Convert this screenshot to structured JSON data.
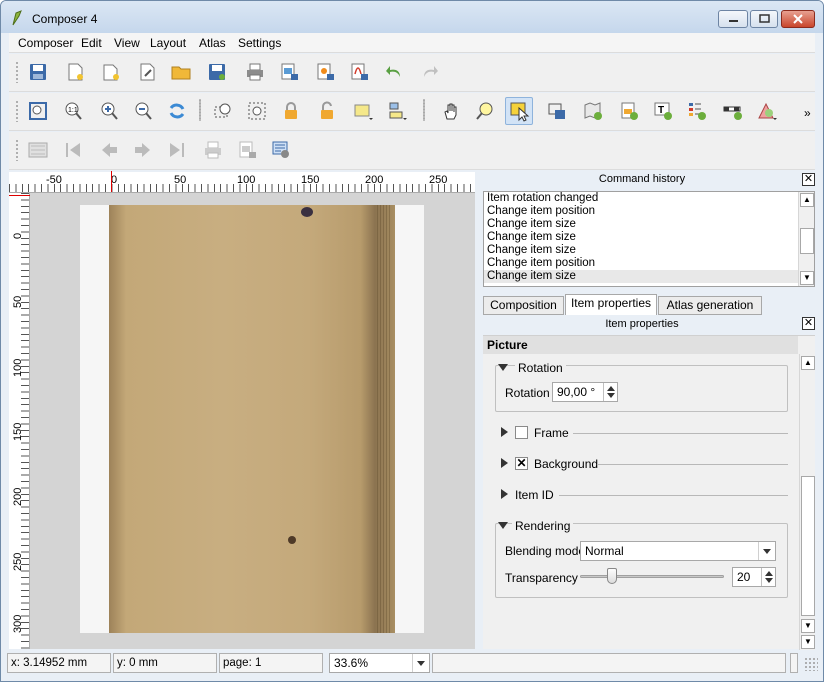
{
  "window": {
    "title": "Composer 4"
  },
  "menu": [
    "Composer",
    "Edit",
    "View",
    "Layout",
    "Atlas",
    "Settings"
  ],
  "ruler": {
    "h_labels": [
      "-50",
      "0",
      "50",
      "100",
      "150",
      "200",
      "250"
    ],
    "v_labels": [
      "0",
      "50",
      "100",
      "150",
      "200",
      "250",
      "300"
    ]
  },
  "command_history": {
    "title": "Command history",
    "items": [
      "Item rotation changed",
      "Change item position",
      "Change item size",
      "Change item size",
      "Change item size",
      "Change item position",
      "Change item size"
    ],
    "selected_index": 6
  },
  "tabs": [
    "Composition",
    "Item properties",
    "Atlas generation"
  ],
  "active_tab": "Item properties",
  "item_properties": {
    "title": "Item properties",
    "section": "Picture",
    "rotation": {
      "group_label": "Rotation",
      "label": "Rotation",
      "value": "90,00 °"
    },
    "frame": {
      "label": "Frame",
      "checked": false
    },
    "background": {
      "label": "Background",
      "checked": true
    },
    "item_id": {
      "label": "Item ID"
    },
    "rendering": {
      "group_label": "Rendering",
      "blending_label": "Blending mode",
      "blending_value": "Normal",
      "transparency_label": "Transparency",
      "transparency_value": "20"
    }
  },
  "status": {
    "x": "x: 3.14952 mm",
    "y": "y: 0 mm",
    "page": "page: 1",
    "zoom": "33.6%"
  },
  "colors": {
    "accent": "#d2e3f6",
    "paper": "#c8ae81"
  }
}
